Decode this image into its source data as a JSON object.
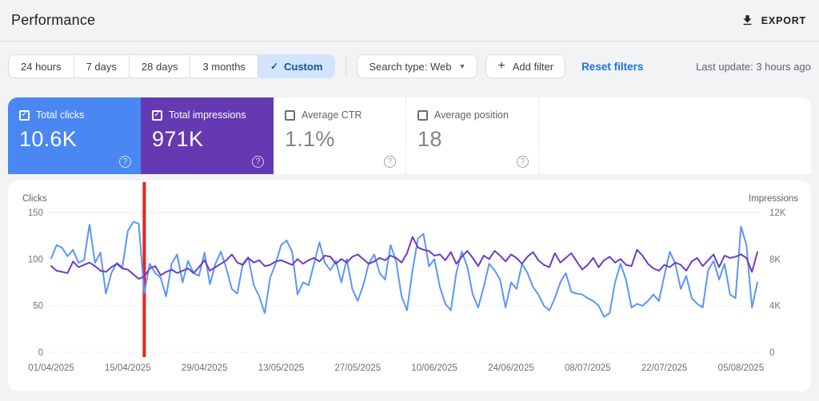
{
  "header": {
    "title": "Performance",
    "export_label": "EXPORT"
  },
  "filters": {
    "date_ranges": [
      {
        "label": "24 hours",
        "selected": false
      },
      {
        "label": "7 days",
        "selected": false
      },
      {
        "label": "28 days",
        "selected": false
      },
      {
        "label": "3 months",
        "selected": false
      },
      {
        "label": "Custom",
        "selected": true
      }
    ],
    "search_type_label": "Search type: Web",
    "add_filter_label": "Add filter",
    "reset_filters_label": "Reset filters",
    "last_update": "Last update: 3 hours ago"
  },
  "metrics": [
    {
      "label": "Total clicks",
      "value": "10.6K",
      "checked": true,
      "color": "#4a87f2"
    },
    {
      "label": "Total impressions",
      "value": "971K",
      "checked": true,
      "color": "#6439b2"
    },
    {
      "label": "Average CTR",
      "value": "1.1%",
      "checked": false,
      "color": "#ffffff"
    },
    {
      "label": "Average position",
      "value": "18",
      "checked": false,
      "color": "#ffffff"
    }
  ],
  "chart_data": {
    "type": "line",
    "x_start": "01/04/2025",
    "x_end": "08/08/2025",
    "x_interval": "daily",
    "x_ticks": [
      {
        "index": 0,
        "label": "01/04/2025"
      },
      {
        "index": 14,
        "label": "15/04/2025"
      },
      {
        "index": 28,
        "label": "29/04/2025"
      },
      {
        "index": 42,
        "label": "13/05/2025"
      },
      {
        "index": 56,
        "label": "27/05/2025"
      },
      {
        "index": 70,
        "label": "10/06/2025"
      },
      {
        "index": 84,
        "label": "24/06/2025"
      },
      {
        "index": 98,
        "label": "08/07/2025"
      },
      {
        "index": 112,
        "label": "22/07/2025"
      },
      {
        "index": 126,
        "label": "05/08/2025"
      }
    ],
    "left_axis": {
      "title": "Clicks",
      "max": 150,
      "tick_values": [
        150,
        100,
        50,
        0
      ],
      "tick_labels": [
        "150",
        "100",
        "50",
        "0"
      ]
    },
    "right_axis": {
      "title": "Impressions",
      "max": 12000,
      "tick_values": [
        12000,
        8000,
        4000,
        0
      ],
      "tick_labels": [
        "12K",
        "8K",
        "4K",
        "0"
      ]
    },
    "annotation": {
      "type": "vertical-line",
      "index": 17,
      "date": "18/04/2025",
      "color": "#e8241b"
    },
    "grid": true,
    "series": [
      {
        "name": "Clicks",
        "axis": "left",
        "color": "#5b96f7",
        "values": [
          101,
          115,
          112,
          103,
          110,
          96,
          99,
          137,
          96,
          107,
          63,
          85,
          96,
          91,
          130,
          140,
          138,
          63,
          95,
          85,
          80,
          60,
          95,
          105,
          75,
          98,
          85,
          82,
          107,
          73,
          95,
          108,
          90,
          68,
          63,
          95,
          102,
          72,
          60,
          42,
          80,
          95,
          115,
          120,
          108,
          62,
          75,
          72,
          95,
          118,
          96,
          88,
          98,
          75,
          100,
          68,
          55,
          72,
          95,
          105,
          85,
          78,
          115,
          98,
          60,
          45,
          88,
          122,
          127,
          92,
          100,
          70,
          52,
          45,
          85,
          108,
          92,
          62,
          48,
          70,
          95,
          88,
          78,
          48,
          75,
          68,
          95,
          85,
          70,
          62,
          50,
          45,
          58,
          75,
          85,
          65,
          63,
          62,
          58,
          55,
          50,
          38,
          42,
          75,
          95,
          78,
          48,
          52,
          50,
          55,
          62,
          55,
          82,
          108,
          95,
          68,
          82,
          58,
          52,
          48,
          88,
          98,
          78,
          95,
          62,
          58,
          135,
          115,
          48,
          75
        ]
      },
      {
        "name": "Impressions",
        "axis": "right",
        "color": "#6d3cc4",
        "values": [
          7400,
          7000,
          6900,
          6800,
          7800,
          7300,
          7500,
          7700,
          7400,
          7000,
          6900,
          7300,
          7600,
          7200,
          7100,
          6700,
          6300,
          6500,
          7200,
          7400,
          6600,
          6900,
          7100,
          6800,
          7000,
          7200,
          6800,
          7300,
          7900,
          7000,
          7300,
          7600,
          7900,
          8400,
          7700,
          7500,
          8100,
          7700,
          7900,
          7400,
          7500,
          7800,
          7900,
          7700,
          7500,
          8000,
          7600,
          7900,
          8100,
          7800,
          8300,
          8200,
          7600,
          8000,
          7700,
          8200,
          8400,
          8000,
          7600,
          7800,
          8100,
          7900,
          8300,
          8100,
          7700,
          8500,
          9900,
          9000,
          8800,
          8700,
          8300,
          8400,
          7900,
          8600,
          7600,
          8200,
          8700,
          8100,
          7400,
          8300,
          8000,
          8700,
          8300,
          7800,
          8400,
          8100,
          7600,
          8200,
          8600,
          7900,
          7500,
          7300,
          8500,
          7700,
          8100,
          8500,
          7800,
          7100,
          7500,
          8100,
          7300,
          7900,
          8200,
          7700,
          8000,
          7500,
          7400,
          8800,
          8300,
          7600,
          7200,
          7000,
          7500,
          7300,
          7700,
          7500,
          7000,
          7800,
          8100,
          7400,
          7900,
          8400,
          7300,
          8300,
          8100,
          8200,
          8400,
          8100,
          6900,
          8600
        ]
      }
    ]
  }
}
